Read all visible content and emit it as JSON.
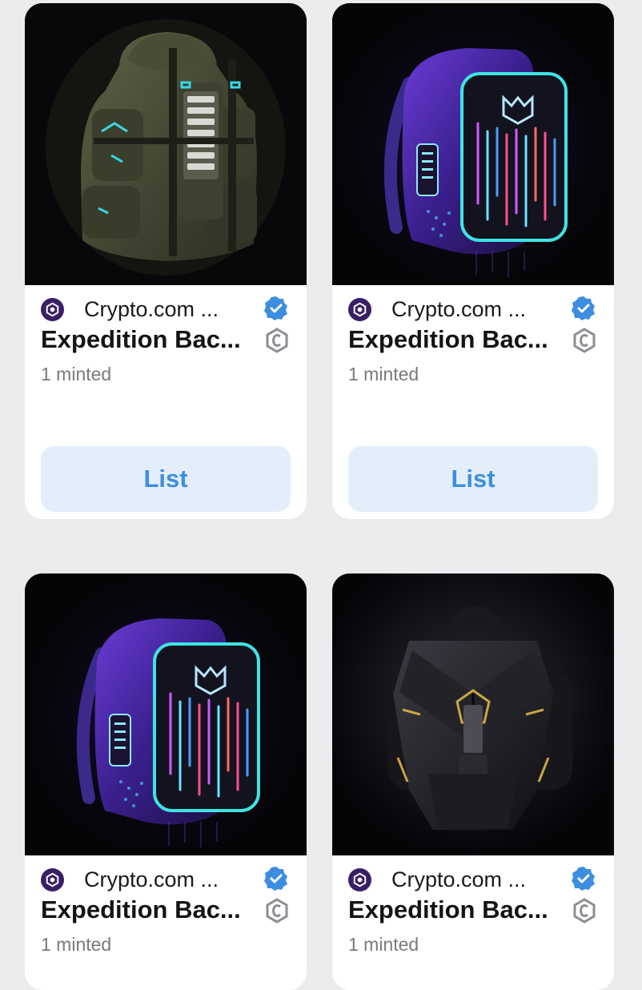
{
  "colors": {
    "page_bg": "#ececee",
    "card_bg": "#ffffff",
    "button_bg": "#e4eefb",
    "button_text": "#3d8ee0",
    "verified_blue": "#3d8ee0",
    "creator_purple": "#3a1f66"
  },
  "cards": [
    {
      "image": "olive-green-expedition-backpack",
      "creator": "Crypto.com ...",
      "creator_icon": "crypto-com-lion-logo-icon",
      "verified_icon": "verified-badge-icon",
      "title": "Expedition Bac...",
      "currency_icon": "cro-coin-icon",
      "minted": "1 minted",
      "action_label": "List"
    },
    {
      "image": "neon-purple-led-backpack",
      "creator": "Crypto.com ...",
      "creator_icon": "crypto-com-lion-logo-icon",
      "verified_icon": "verified-badge-icon",
      "title": "Expedition Bac...",
      "currency_icon": "cro-coin-icon",
      "minted": "1 minted",
      "action_label": "List"
    },
    {
      "image": "neon-purple-led-backpack",
      "creator": "Crypto.com ...",
      "creator_icon": "crypto-com-lion-logo-icon",
      "verified_icon": "verified-badge-icon",
      "title": "Expedition Bac...",
      "currency_icon": "cro-coin-icon",
      "minted": "1 minted"
    },
    {
      "image": "black-gold-armored-backpack",
      "creator": "Crypto.com ...",
      "creator_icon": "crypto-com-lion-logo-icon",
      "verified_icon": "verified-badge-icon",
      "title": "Expedition Bac...",
      "currency_icon": "cro-coin-icon",
      "minted": "1 minted"
    }
  ]
}
